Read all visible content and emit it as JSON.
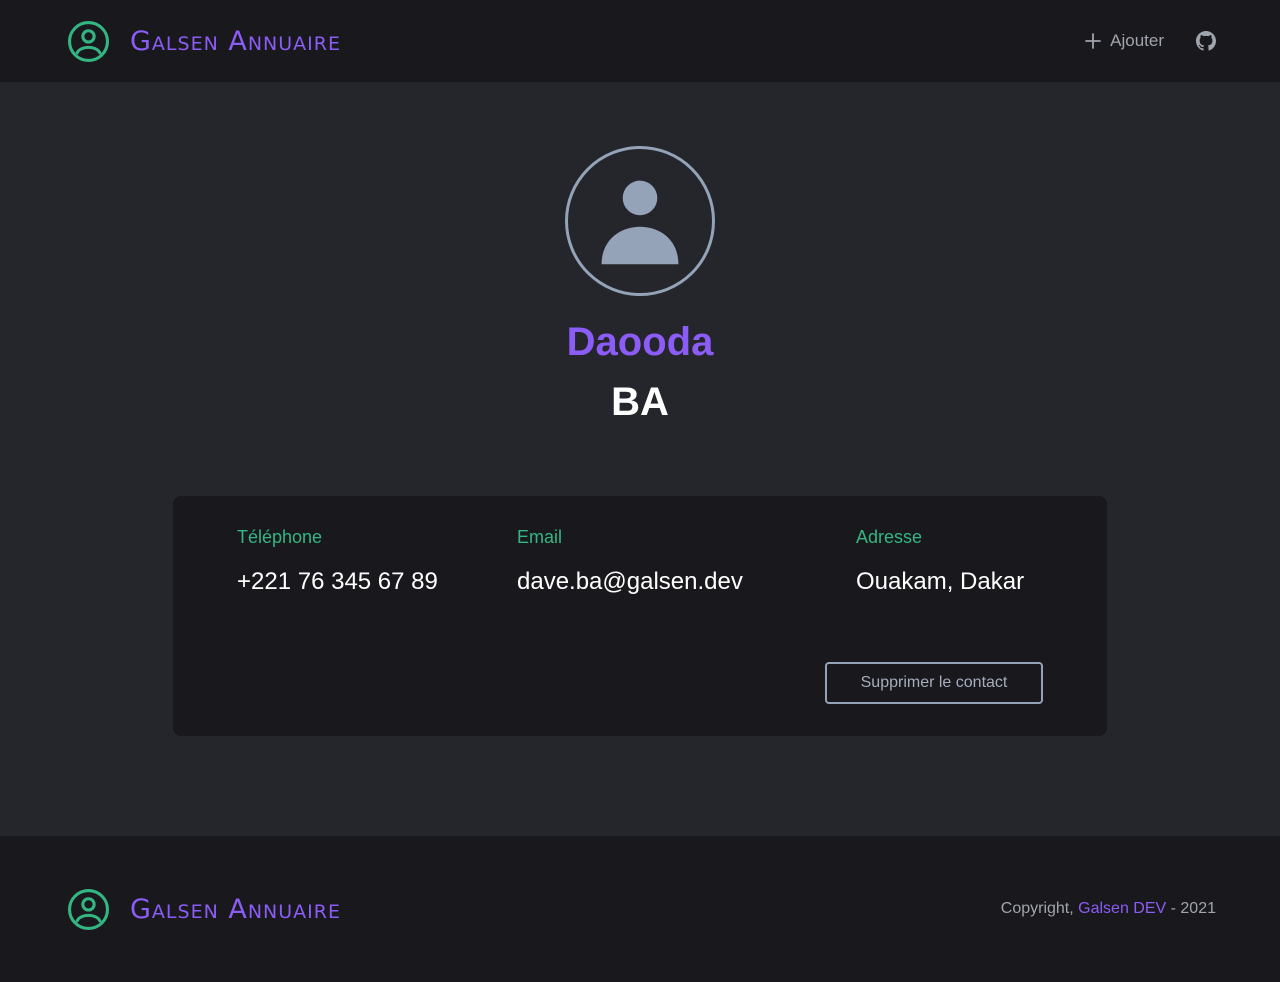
{
  "header": {
    "brand": "Galsen Annuaire",
    "add_label": "Ajouter",
    "add_icon": "plus-icon",
    "github_icon": "github-icon"
  },
  "contact": {
    "first_name": "Daooda",
    "last_name": "BA",
    "avatar_icon": "user-avatar-icon",
    "phone_label": "Téléphone",
    "phone": "+221 76 345 67 89",
    "email_label": "Email",
    "email": "dave.ba@galsen.dev",
    "address_label": "Adresse",
    "address": "Ouakam, Dakar",
    "delete_label": "Supprimer le contact"
  },
  "footer": {
    "brand": "Galsen Annuaire",
    "copyright_prefix": "Copyright, ",
    "copyright_link": "Galsen DEV",
    "copyright_suffix": " - 2021"
  },
  "colors": {
    "accent": "#8b5cf6",
    "green": "#34b683",
    "background": "#24262b",
    "surface": "#18181d",
    "muted": "#94a3b8"
  }
}
